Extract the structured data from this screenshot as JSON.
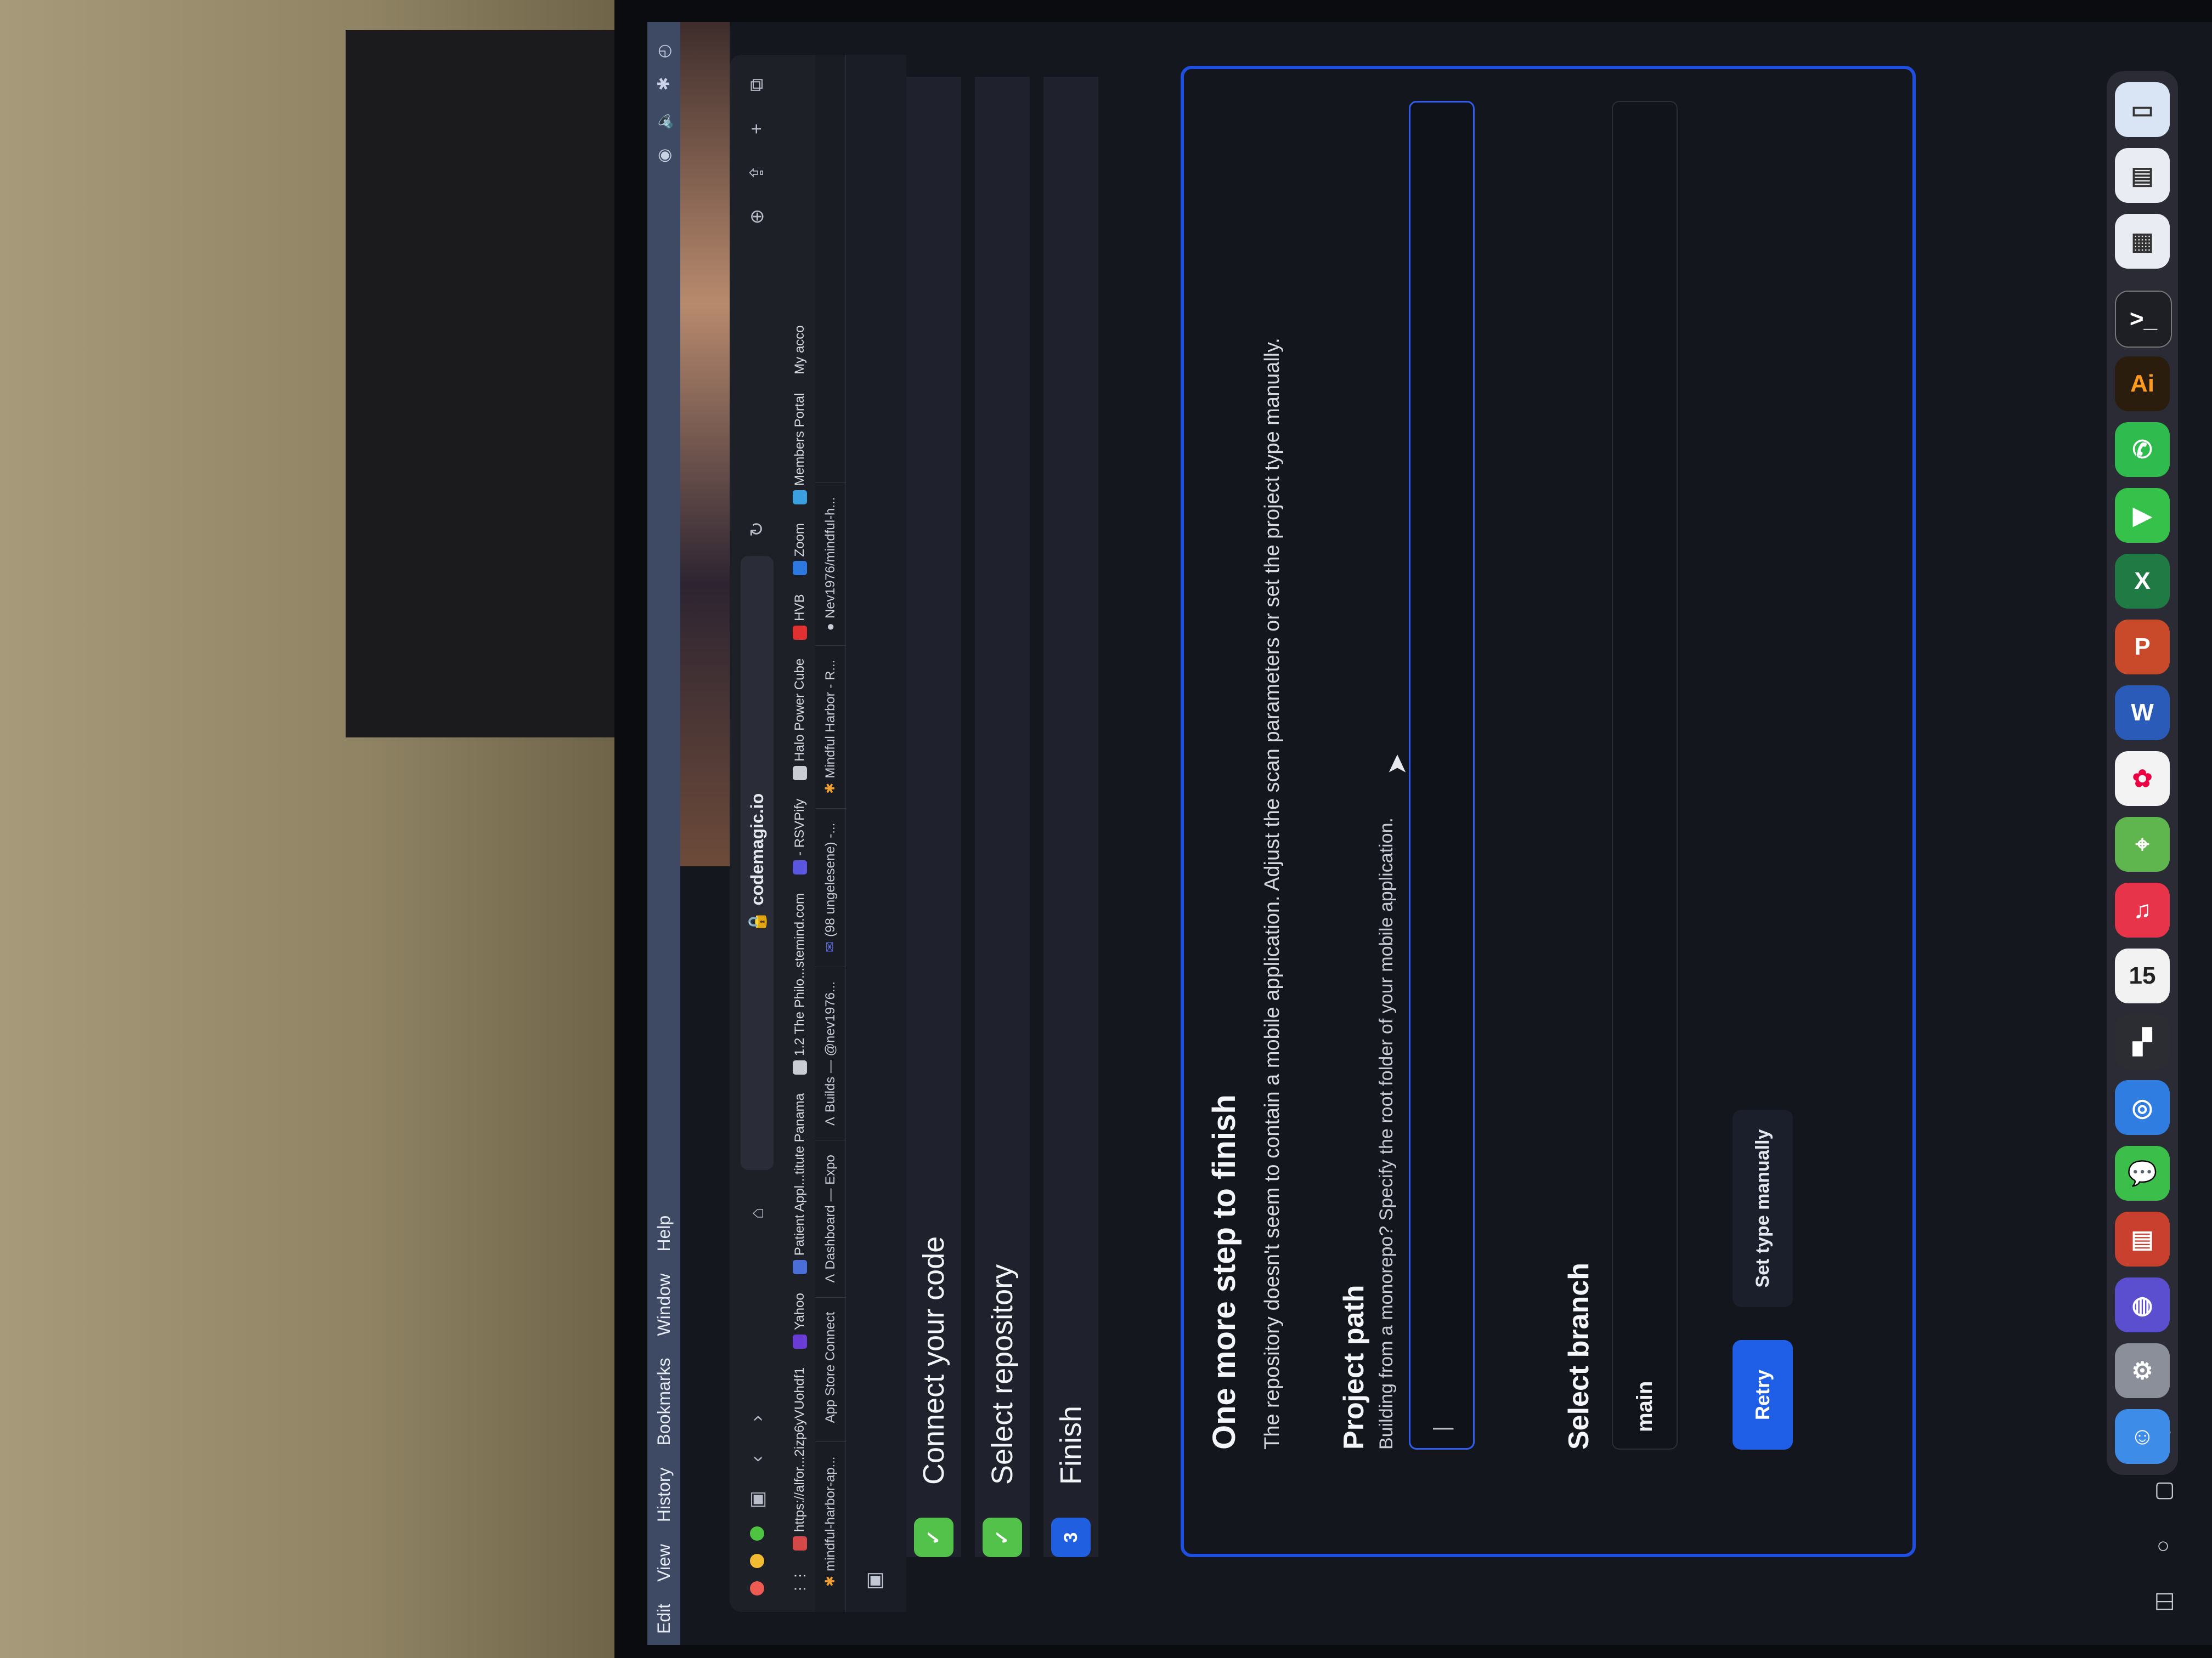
{
  "menubar": {
    "items": [
      "Edit",
      "View",
      "History",
      "Bookmarks",
      "Window",
      "Help"
    ]
  },
  "browser": {
    "url": "codemagic.io",
    "bookmarks": [
      {
        "label": "https://alfor...2izp6yVUohdf1",
        "color": "#d44848"
      },
      {
        "label": "Yahoo",
        "color": "#6a3cd6"
      },
      {
        "label": "Patient Appl...titute Panama",
        "color": "#4a6fd8"
      },
      {
        "label": "1.2 The Philo...stemind.com",
        "color": "#c9ccd3"
      },
      {
        "label": "- RSVPify",
        "color": "#5b56e0"
      },
      {
        "label": "Halo Power Cube",
        "color": "#c9ccd3"
      },
      {
        "label": "HVB",
        "color": "#e03030"
      },
      {
        "label": "Zoom",
        "color": "#2d79e0"
      },
      {
        "label": "Members Portal",
        "color": "#3aa0e0"
      },
      {
        "label": "My acco",
        "color": "#c9ccd3"
      }
    ],
    "tabs": [
      {
        "label": "mindful-harbor-ap...",
        "color": "#f0a030"
      },
      {
        "label": "App Store Connect",
        "color": "#c9ccd3"
      },
      {
        "label": "Dashboard — Expo",
        "color": "#e6e8ee"
      },
      {
        "label": "Builds — @nev1976...",
        "color": "#e6e8ee"
      },
      {
        "label": "(98 ungelesene) -...",
        "color": "#5b6be0"
      },
      {
        "label": "Mindful Harbor - R...",
        "color": "#f0a030"
      },
      {
        "label": "Nev1976/mindful-h...",
        "color": "#e6e8ee"
      }
    ]
  },
  "wizard": {
    "steps": [
      {
        "badge": "✓",
        "label": "Connect your code",
        "state": "done"
      },
      {
        "badge": "✓",
        "label": "Select repository",
        "state": "done"
      },
      {
        "badge": "3",
        "label": "Finish",
        "state": "active"
      }
    ],
    "title": "One more step to finish",
    "description": "The repository doesn't seem to contain a mobile application. Adjust the scan parameters or set the project type manually.",
    "project_path": {
      "title": "Project path",
      "help": "Building from a monorepo? Specify the root folder of your mobile application.",
      "value": "|"
    },
    "branch": {
      "title": "Select branch",
      "value": "main"
    },
    "buttons": {
      "retry": "Retry",
      "set_manually": "Set type manually"
    }
  },
  "dock": {
    "calendar_day": "15",
    "apps": [
      "Finder",
      "Launchpad",
      "Siri",
      "Notes",
      "Messages",
      "Safari",
      "Slack",
      "Calendar",
      "Music",
      "Maps",
      "Photos",
      "Word",
      "PowerPoint",
      "Excel",
      "FaceTime",
      "WhatsApp",
      "Illustrator",
      "Terminal",
      "Preview",
      "Files",
      "Finder Window"
    ],
    "illustrator_label": "Ai"
  }
}
